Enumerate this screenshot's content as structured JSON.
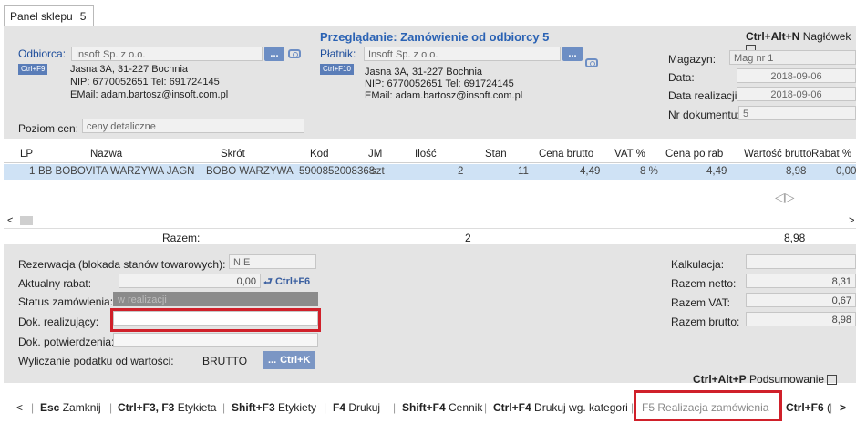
{
  "tab": {
    "label": "Panel sklepu",
    "value": "5"
  },
  "title": "Przeglądanie: Zamówienie od odbiorcy 5",
  "topright": {
    "hotkey": "Ctrl+Alt+N",
    "label": "Nagłówek"
  },
  "buyer": {
    "label": "Odbiorca:",
    "name": "Insoft Sp. z o.o.",
    "badge": "Ctrl+F9",
    "address": "Jasna 3A, 31-227 Bochnia",
    "nip": "NIP: 6770052651 Tel: 691724145",
    "email": "EMail: adam.bartosz@insoft.com.pl"
  },
  "payer": {
    "label": "Płatnik:",
    "name": "Insoft Sp. z o.o.",
    "badge": "Ctrl+F10",
    "address": "Jasna 3A, 31-227 Bochnia",
    "nip": "NIP: 6770052651 Tel: 691724145",
    "email": "EMail: adam.bartosz@insoft.com.pl"
  },
  "price_level": {
    "label": "Poziom cen:",
    "value": "ceny detaliczne"
  },
  "doc": {
    "warehouse_label": "Magazyn:",
    "warehouse": "Mag nr 1",
    "date_label": "Data:",
    "date": "2018-09-06",
    "real_date_label": "Data realizacji:",
    "real_date": "2018-09-06",
    "number_label": "Nr dokumentu:",
    "number": "5"
  },
  "dots": "...",
  "grid": {
    "headers": [
      "LP",
      "Nazwa",
      "Skrót",
      "Kod",
      "JM",
      "Ilość",
      "Stan",
      "Cena brutto",
      "VAT %",
      "Cena po rab",
      "Wartość brutto",
      "Rabat %"
    ],
    "row": [
      "1",
      "BB BOBOVITA WARZYWA JAGN",
      "BOBO WARZYWA .",
      "5900852008368",
      "szt",
      "2",
      "11",
      "4,49",
      "8 %",
      "4,49",
      "8,98",
      "0,00"
    ],
    "sum_label": "Razem:",
    "sum_qty": "2",
    "sum_value": "8,98"
  },
  "bottom": {
    "reservation_label": "Rezerwacja (blokada stanów towarowych):",
    "reservation": "NIE",
    "discount_label": "Aktualny rabat:",
    "discount": "0,00",
    "discount_hotkey": "Ctrl+F6",
    "status_label": "Status zamówienia:",
    "status": "w realizacji",
    "realizing_label": "Dok. realizujący:",
    "realizing": "",
    "confirm_label": "Dok. potwierdzenia:",
    "confirm": "",
    "tax_label": "Wyliczanie podatku od wartości:",
    "tax": "BRUTTO",
    "tax_hotkey": "Ctrl+K",
    "calc_label": "Kalkulacja:",
    "calc": "",
    "net_label": "Razem netto:",
    "net": "8,31",
    "vat_label": "Razem VAT:",
    "vat": "0,67",
    "gross_label": "Razem brutto:",
    "gross": "8,98",
    "summary_hotkey": "Ctrl+Alt+P",
    "summary_label": "Podsumowanie"
  },
  "footer": {
    "prev": "<",
    "b1_key": "Esc",
    "b1": "Zamknij",
    "b2_key": "Ctrl+F3, F3",
    "b2": "Etykieta",
    "b3_key": "Shift+F3",
    "b3": "Etykiety",
    "b4_key": "F4",
    "b4": "Drukuj",
    "b5_key": "Shift+F4",
    "b5": "Cennik",
    "b6_key": "Ctrl+F4",
    "b6": "Drukuj wg. kategorii",
    "b7_key": "F5",
    "b7": "Realizacja zamówienia",
    "b8_key": "Ctrl+F6",
    "b8": "(",
    "next": ">"
  }
}
